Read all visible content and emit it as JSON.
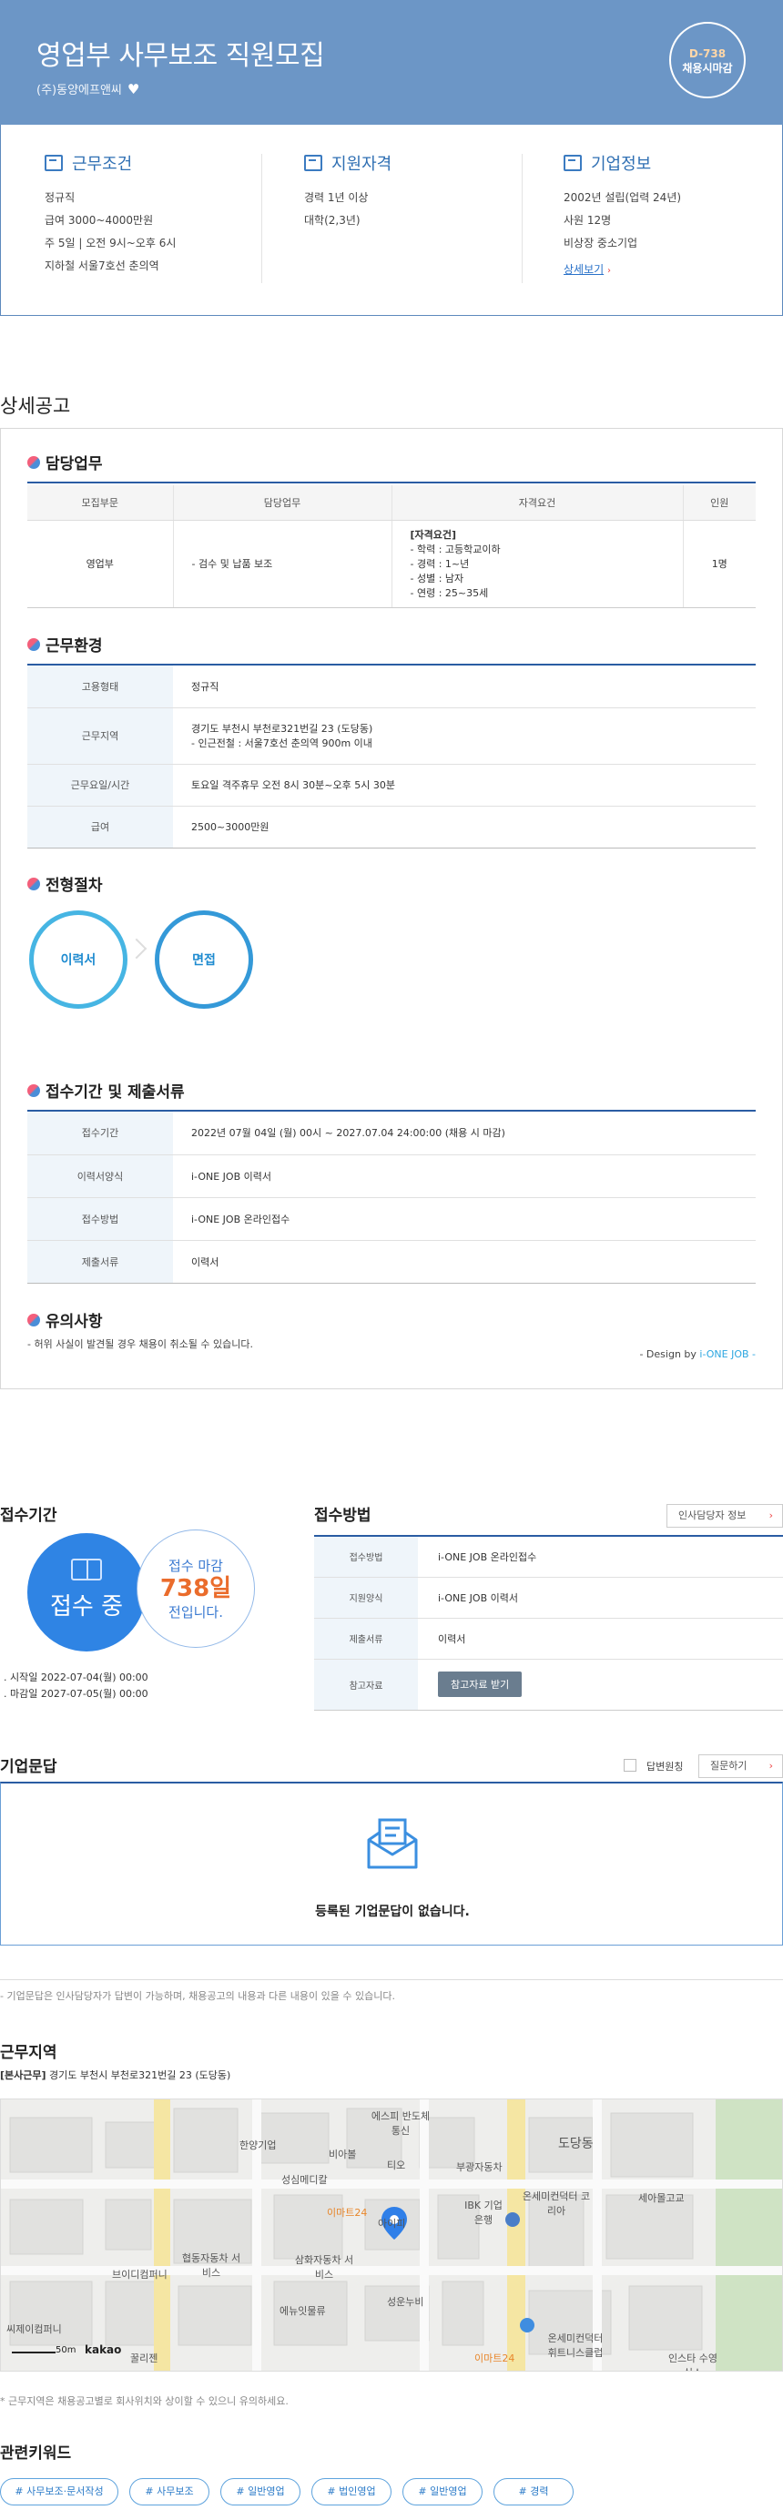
{
  "header": {
    "title": "영업부 사무보조 직원모집",
    "company": "(주)동양에프앤씨",
    "dday": "D-738",
    "deadline_label": "채용시마감"
  },
  "summary": {
    "work": {
      "title": "근무조건",
      "lines": [
        "정규직",
        "급여 3000~4000만원",
        "주 5일 | 오전 9시~오후 6시",
        "지하철 서울7호선 춘의역"
      ]
    },
    "qualify": {
      "title": "지원자격",
      "lines": [
        "경력 1년 이상",
        "대학(2,3년)"
      ]
    },
    "company": {
      "title": "기업정보",
      "lines": [
        "2002년 설립(업력 24년)",
        "사원 12명",
        "비상장 중소기업"
      ],
      "link": "상세보기"
    }
  },
  "detail": {
    "section_title": "상세공고",
    "duty": {
      "title": "담당업무",
      "headers": [
        "모집부문",
        "담당업무",
        "자격요건",
        "인원"
      ],
      "row": {
        "dept": "영업부",
        "task": "- 검수 및 납품 보조",
        "qual_head": "[자격요건]",
        "qual_lines": [
          "- 학력 : 고등학교이하",
          "- 경력 : 1~년",
          "- 성별 : 남자",
          "- 연령 : 25~35세"
        ],
        "count": "1명"
      }
    },
    "env": {
      "title": "근무환경",
      "rows": [
        {
          "k": "고용형태",
          "v": "정규직"
        },
        {
          "k": "근무지역",
          "v": "경기도 부천시 부천로321번길 23 (도당동)",
          "v2": "- 인근전철 : 서울7호선 춘의역 900m 이내"
        },
        {
          "k": "근무요일/시간",
          "v": "토요일 격주휴무 오전 8시 30분~오후 5시 30분"
        },
        {
          "k": "급여",
          "v": "2500~3000만원"
        }
      ]
    },
    "process": {
      "title": "전형절차",
      "steps": [
        "이력서",
        "면접"
      ]
    },
    "submit": {
      "title": "접수기간 및 제출서류",
      "rows": [
        {
          "k": "접수기간",
          "v": "2022년 07월 04일 (월) 00시 ~ 2027.07.04 24:00:00 (채용 시 마감)"
        },
        {
          "k": "이력서양식",
          "v": "i-ONE JOB 이력서"
        },
        {
          "k": "접수방법",
          "v": "i-ONE JOB 온라인접수"
        },
        {
          "k": "제출서류",
          "v": "이력서"
        }
      ]
    },
    "notice": {
      "title": "유의사항",
      "text": "- 허위 사실이 발견될 경우 채용이 취소될 수 있습니다.",
      "design_by": "- Design by ",
      "design_brand": "i-ONE JOB -"
    }
  },
  "receipt": {
    "period_title": "접수기간",
    "status": "접수 중",
    "remain_label": "접수 마감",
    "remain_days": "738일",
    "remain_suffix": "전입니다.",
    "start": "시작일 2022-07-04(월) 00:00",
    "end": "마감일 2027-07-05(월) 00:00",
    "method_title": "접수방법",
    "hr_button": "인사담당자 정보",
    "rows": [
      {
        "k": "접수방법",
        "v": "i-ONE JOB 온라인접수"
      },
      {
        "k": "지원양식",
        "v": "i-ONE JOB 이력서"
      },
      {
        "k": "제출서류",
        "v": "이력서"
      },
      {
        "k": "참고자료",
        "v": "참고자료 받기"
      }
    ]
  },
  "qna": {
    "title": "기업문답",
    "check_label": "답변원칭",
    "ask_button": "질문하기",
    "empty": "등록된 기업문답이 없습니다.",
    "note": "- 기업문답은 인사담당자가 답변이 가능하며, 채용공고의 내용과 다른 내용이 있을 수 있습니다."
  },
  "location": {
    "title": "근무지역",
    "addr_prefix": "[본사근무]",
    "addr": " 경기도 부천시 부천로321번길 23 (도당동)",
    "note": "* 근무지역은 채용공고별로 회사위치와 상이할 수 있으니 유의하세요.",
    "map_labels": [
      "한양기업",
      "에스피 반도체통신",
      "비아볼",
      "성심메디칼",
      "티오",
      "부광자동차",
      "도당동",
      "이마트24",
      "아이피",
      "IBK 기업은행",
      "온세미컨덕터 코리아",
      "세아몰고교",
      "협동자동차 서비스",
      "삼화자동차 서비스",
      "브이디컴퍼니",
      "에뉴잇물류",
      "성운누비",
      "씨제이컴퍼니",
      "꿀리젠",
      "이마트24",
      "온세미컨덕터 휘트니스클럽",
      "인스타 수영십스"
    ],
    "scale": "50m",
    "map_brand": "kakao"
  },
  "keywords": {
    "title": "관련키워드",
    "items": [
      "# 사무보조·문서작성",
      "# 사무보조",
      "# 일반영업",
      "# 법인영업",
      "# 일반영업",
      "# 경력"
    ]
  },
  "colors": {
    "header_bg": "#6c96c6",
    "accent": "#2a5ca3",
    "dday_color": "#ffd7a8",
    "remain_color": "#ea6c2c"
  }
}
